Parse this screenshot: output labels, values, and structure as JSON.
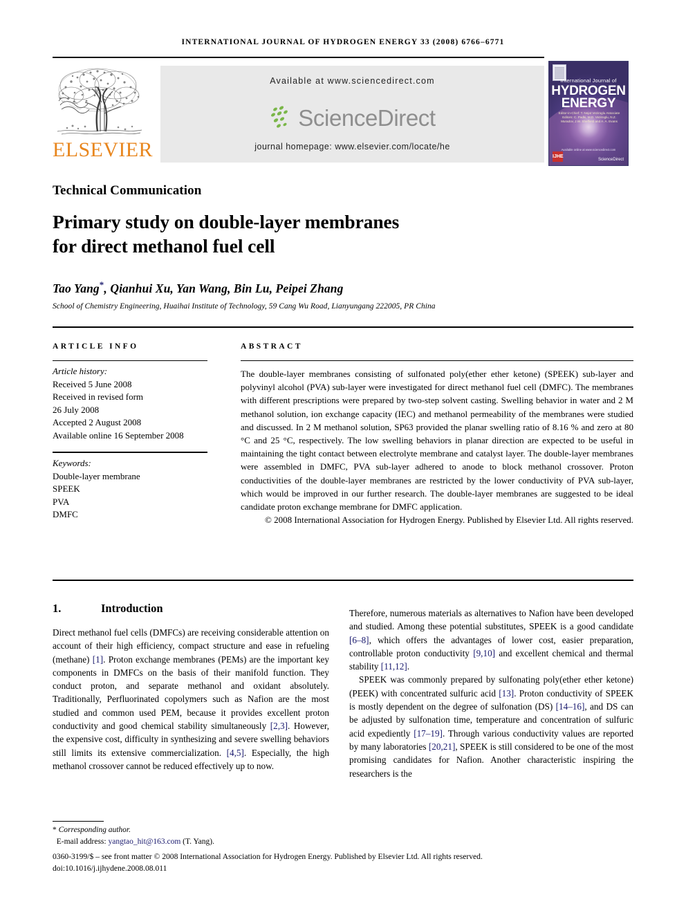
{
  "running_head": "INTERNATIONAL JOURNAL OF HYDROGEN ENERGY 33 (2008) 6766–6771",
  "publisher": {
    "logo_wordmark": "ELSEVIER",
    "logo_color": "#E8861E",
    "tree_icon": "elsevier-tree-emblem"
  },
  "sciencedirect": {
    "available_at": "Available at www.sciencedirect.com",
    "wordmark": "ScienceDirect",
    "journal_homepage": "journal homepage: www.elsevier.com/locate/he",
    "panel_color": "#e9e9e9",
    "leaf_color": "#7ab648",
    "word_color": "#8e8e8e"
  },
  "cover": {
    "pretitle": "International Journal of",
    "title_line1": "HYDROGEN",
    "title_line2": "ENERGY",
    "editors": "Editor-in-Chief:  T. Nejat Veziroglu   Associate Editors:  C. Padki, M.D. Veziroglu,  N.Z. Muradov, J.W. Sheffield and A. A. Evans",
    "badge": "IJHE",
    "sciencedirect_tag": "Available online at www.sciencedirect.com",
    "sciencedirect_mark": "ScienceDirect"
  },
  "article": {
    "type": "Technical Communication",
    "title_line1": "Primary study on double-layer membranes",
    "title_line2": "for direct methanol fuel cell",
    "authors": "Tao Yang, Qianhui Xu, Yan Wang, Bin Lu, Peipei Zhang",
    "corresponding_marker": "*",
    "affiliation": "School of Chemistry Engineering, Huaihai Institute of Technology, 59 Cang Wu Road, Lianyungang 222005, PR China"
  },
  "info": {
    "heading": "ARTICLE INFO",
    "history_label": "Article history:",
    "history": [
      "Received 5 June 2008",
      "Received in revised form",
      "26 July 2008",
      "Accepted 2 August 2008",
      "Available online 16 September 2008"
    ],
    "keywords_label": "Keywords:",
    "keywords": [
      "Double-layer membrane",
      "SPEEK",
      "PVA",
      "DMFC"
    ]
  },
  "abstract": {
    "heading": "ABSTRACT",
    "body": "The double-layer membranes consisting of sulfonated poly(ether ether ketone) (SPEEK) sub-layer and polyvinyl alcohol (PVA) sub-layer were investigated for direct methanol fuel cell (DMFC). The membranes with different prescriptions were prepared by two-step solvent casting. Swelling behavior in water and 2 M methanol solution, ion exchange capacity (IEC) and methanol permeability of the membranes were studied and discussed. In 2 M methanol solution, SP63 provided the planar swelling ratio of 8.16 % and zero at 80 °C and 25 °C, respectively. The low swelling behaviors in planar direction are expected to be useful in maintaining the tight contact between electrolyte membrane and catalyst layer. The double-layer membranes were assembled in DMFC, PVA sub-layer adhered to anode to block methanol crossover. Proton conductivities of the double-layer membranes are restricted by the lower conductivity of PVA sub-layer, which would be improved in our further research. The double-layer membranes are suggested to be ideal candidate proton exchange membrane for DMFC application.",
    "copyright": "© 2008 International Association for Hydrogen Energy. Published by Elsevier Ltd. All rights reserved."
  },
  "introduction": {
    "number": "1.",
    "title": "Introduction",
    "left_column": "Direct methanol fuel cells (DMFCs) are receiving considerable attention on account of their high efficiency, compact structure and ease in refueling (methane) [1]. Proton exchange membranes (PEMs) are the important key components in DMFCs on the basis of their manifold function. They conduct proton, and separate methanol and oxidant absolutely. Traditionally, Perfluorinated copolymers such as Nafion are the most studied and common used PEM, because it provides excellent proton conductivity and good chemical stability simultaneously [2,3]. However, the expensive cost, difficulty in synthesizing and severe swelling behaviors still limits its extensive commercialization. [4,5]. Especially, the high methanol crossover cannot be reduced effectively up to now.",
    "right_paragraph_1": "Therefore, numerous materials as alternatives to Nafion have been developed and studied. Among these potential substitutes, SPEEK is a good candidate [6–8], which offers the advantages of lower cost, easier preparation, controllable proton conductivity [9,10] and excellent chemical and thermal stability [11,12].",
    "right_paragraph_2": "SPEEK was commonly prepared by sulfonating poly(ether ether ketone) (PEEK) with concentrated sulfuric acid [13]. Proton conductivity of SPEEK is mostly dependent on the degree of sulfonation (DS) [14–16], and DS can be adjusted by sulfonation time, temperature and concentration of sulfuric acid expediently [17–19]. Through various conductivity values are reported by many laboratories [20,21], SPEEK is still considered to be one of the most promising candidates for Nafion. Another characteristic inspiring the researchers is the"
  },
  "footer": {
    "corresponding_marker": "*",
    "corresponding_label": "Corresponding author.",
    "email_label": "E-mail address:",
    "email": "yangtao_hit@163.com",
    "email_owner": "(T. Yang).",
    "issn_line": "0360-3199/$ – see front matter © 2008 International Association for Hydrogen Energy. Published by Elsevier Ltd. All rights reserved.",
    "doi_line": "doi:10.1016/j.ijhydene.2008.08.011",
    "link_color": "#1a1a6e"
  }
}
